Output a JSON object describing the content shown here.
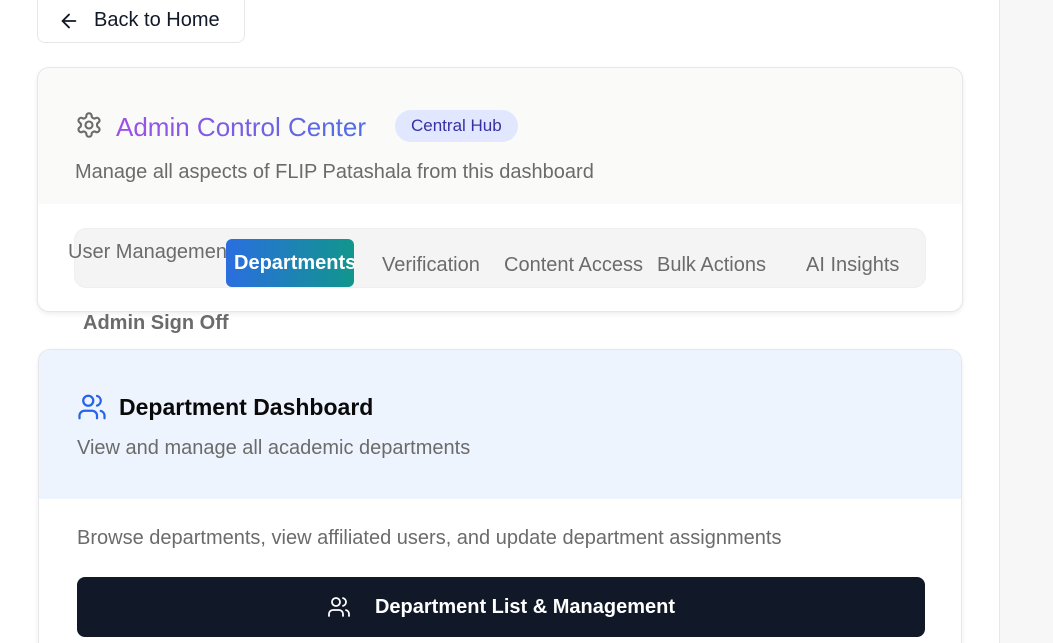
{
  "back_button": {
    "label": "Back to Home"
  },
  "admin": {
    "title": "Admin Control Center",
    "badge": "Central Hub",
    "subtitle": "Manage all aspects of FLIP Patashala from this dashboard",
    "tabs": [
      {
        "label": "User Management"
      },
      {
        "label": "Departments"
      },
      {
        "label": "Verification"
      },
      {
        "label": "Content Access"
      },
      {
        "label": "Bulk Actions"
      },
      {
        "label": "AI Insights"
      },
      {
        "label": "Admin Sign Off"
      }
    ]
  },
  "department": {
    "title": "Department Dashboard",
    "subtitle": "View and manage all academic departments",
    "description": "Browse departments, view affiliated users, and update department assignments",
    "button_label": "Department List & Management"
  },
  "icons": {
    "back": "arrow-left-icon",
    "settings": "gear-icon",
    "users": "users-icon"
  },
  "colors": {
    "title_gradient_start": "#a04fe6",
    "title_gradient_end": "#4d6fe2",
    "active_tab_start": "#2a6ee0",
    "active_tab_end": "#11968c",
    "badge_bg": "#e0e7ff",
    "primary_button": "#111827",
    "users_icon": "#2563eb"
  }
}
